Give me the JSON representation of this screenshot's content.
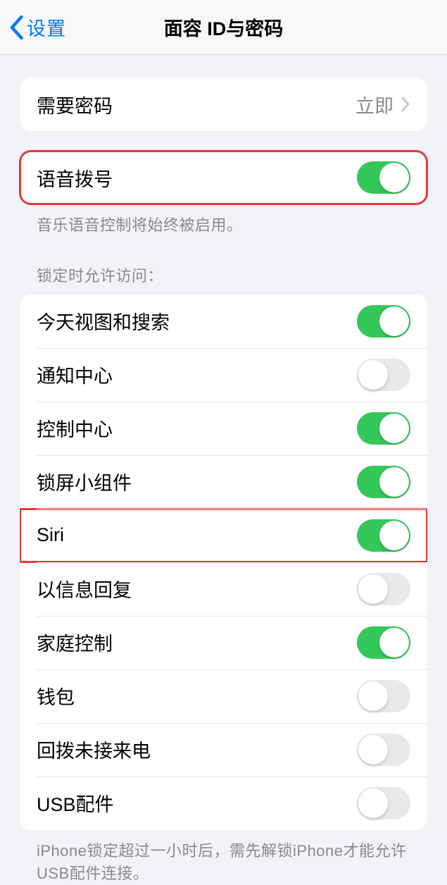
{
  "header": {
    "back": "设置",
    "title": "面容 ID与密码"
  },
  "group1": {
    "require_passcode": {
      "label": "需要密码",
      "value": "立即"
    }
  },
  "group2": {
    "voice_dial": {
      "label": "语音拨号",
      "on": true
    },
    "footer": "音乐语音控制将始终被启用。"
  },
  "section_header": "锁定时允许访问：",
  "group3": {
    "items": [
      {
        "label": "今天视图和搜索",
        "on": true
      },
      {
        "label": "通知中心",
        "on": false
      },
      {
        "label": "控制中心",
        "on": true
      },
      {
        "label": "锁屏小组件",
        "on": true
      },
      {
        "label": "Siri",
        "on": true
      },
      {
        "label": "以信息回复",
        "on": false
      },
      {
        "label": "家庭控制",
        "on": true
      },
      {
        "label": "钱包",
        "on": false
      },
      {
        "label": "回拨未接来电",
        "on": false
      },
      {
        "label": "USB配件",
        "on": false
      }
    ],
    "footer": "iPhone锁定超过一小时后，需先解锁iPhone才能允许USB配件连接。"
  }
}
